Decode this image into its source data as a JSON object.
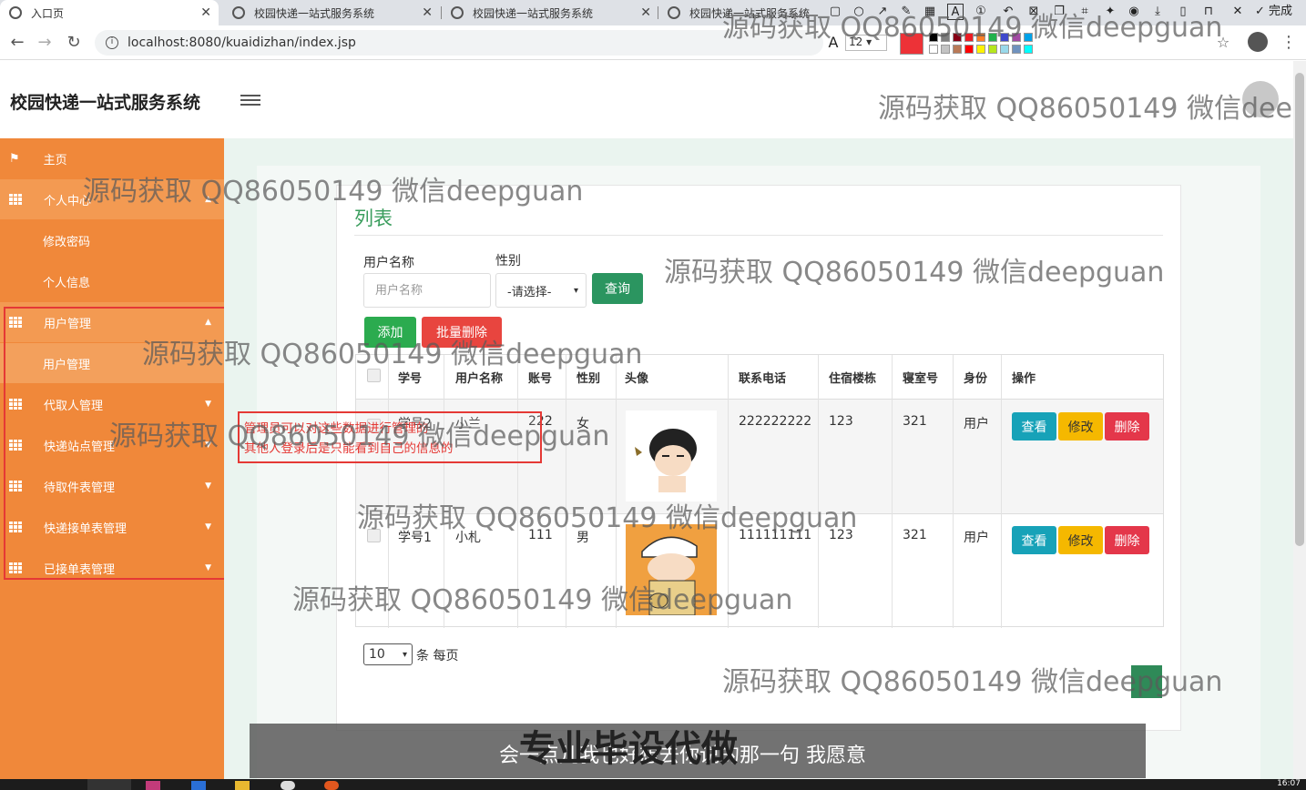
{
  "browser": {
    "tabs": [
      {
        "title": "入口页",
        "active": true
      },
      {
        "title": "校园快递一站式服务系统",
        "active": false
      },
      {
        "title": "校园快递一站式服务系统",
        "active": false
      },
      {
        "title": "校园快递一站式服务系统",
        "active": false
      }
    ],
    "url": "localhost:8080/kuaidizhan/index.jsp",
    "annotation_toolbar": {
      "font_size": "12",
      "done_label": "完成",
      "font_icon": "A",
      "colors": [
        "#000000",
        "#7f7f7f",
        "#880015",
        "#ed1c24",
        "#ff7f27",
        "#22b14c",
        "#3f48cc",
        "#a349a4",
        "#00a2e8",
        "#ffffff",
        "#c3c3c3",
        "#b97a57",
        "#ff0000",
        "#fff200",
        "#b5e61d",
        "#99d9ea",
        "#7092be",
        "#00ffff"
      ],
      "selected_color": "#ed3237"
    }
  },
  "app": {
    "title": "校园快递一站式服务系统"
  },
  "sidebar": {
    "items": [
      {
        "label": "主页",
        "icon": "flag-icon"
      },
      {
        "label": "个人中心",
        "icon": "grid-icon",
        "expanded": true,
        "children": [
          "修改密码",
          "个人信息"
        ]
      },
      {
        "label": "用户管理",
        "icon": "grid-icon",
        "expanded": true,
        "children": [
          "用户管理"
        ]
      },
      {
        "label": "代取人管理",
        "icon": "grid-icon",
        "expanded": false
      },
      {
        "label": "快递站点管理",
        "icon": "grid-icon",
        "expanded": false
      },
      {
        "label": "待取件表管理",
        "icon": "grid-icon",
        "expanded": false
      },
      {
        "label": "快递接单表管理",
        "icon": "grid-icon",
        "expanded": false
      },
      {
        "label": "已接单表管理",
        "icon": "grid-icon",
        "expanded": false
      }
    ]
  },
  "panel": {
    "title": "列表",
    "search": {
      "username_label": "用户名称",
      "username_placeholder": "用户名称",
      "sex_label": "性别",
      "sex_value": "-请选择-",
      "query_button": "查询"
    },
    "add_button": "添加",
    "batch_delete_button": "批量删除",
    "table": {
      "headers": [
        "学号",
        "用户名称",
        "账号",
        "性别",
        "头像",
        "联系电话",
        "住宿楼栋",
        "寝室号",
        "身份",
        "操作"
      ],
      "rows": [
        {
          "xuehao": "学号2",
          "name": "小兰",
          "account": "222",
          "sex": "女",
          "phone": "222222222",
          "building": "123",
          "room": "321",
          "role": "用户"
        },
        {
          "xuehao": "学号1",
          "name": "小札",
          "account": "111",
          "sex": "男",
          "phone": "111111111",
          "building": "123",
          "room": "321",
          "role": "用户"
        }
      ],
      "actions": {
        "view": "查看",
        "edit": "修改",
        "delete": "删除"
      }
    },
    "page_size": "10",
    "page_size_label": "条 每页"
  },
  "annotation": {
    "line1": "管理员可以对这些数据进行管理的",
    "line2": "其他人登录后是只能看到自己的信息的"
  },
  "watermark": "源码获取 QQ86050149 微信deepguan",
  "subtitle": "会一点儿我也好想去你说的那一句 我愿意",
  "banner": "专业毕设代做",
  "clock": "16:07"
}
